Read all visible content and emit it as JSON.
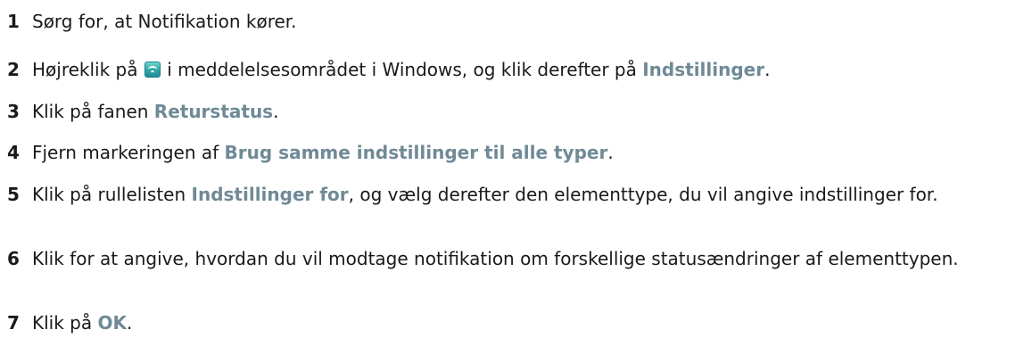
{
  "steps": [
    {
      "num": "1",
      "text": "Sørg for, at Notifikation kører."
    },
    {
      "num": "2",
      "pre": "Højreklik på ",
      "icon": "notification-tray-icon",
      "mid": " i meddelelsesområdet i Windows, og klik derefter på ",
      "ui": "Indstillinger",
      "post": "."
    },
    {
      "num": "3",
      "pre": "Klik på fanen ",
      "ui": "Returstatus",
      "post": "."
    },
    {
      "num": "4",
      "pre": "Fjern markeringen af ",
      "ui": "Brug samme indstillinger til alle typer",
      "post": "."
    },
    {
      "num": "5",
      "pre": "Klik på rullelisten ",
      "ui": "Indstillinger for",
      "post": ", og vælg derefter den elementtype, du vil angive indstillinger for."
    },
    {
      "num": "6",
      "text": "Klik for at angive, hvordan du vil modtage notifikation om forskellige statusændringer af elementtypen."
    },
    {
      "num": "7",
      "pre": "Klik på ",
      "ui": "OK",
      "post": "."
    }
  ]
}
